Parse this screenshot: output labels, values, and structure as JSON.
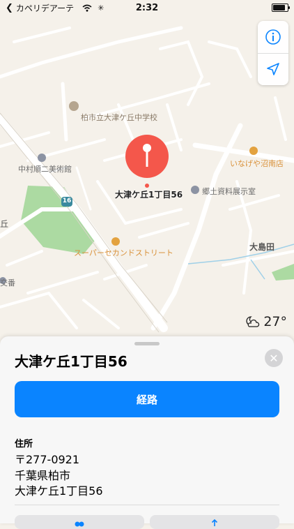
{
  "status_bar": {
    "back_app": "カペリデアーテ",
    "time": "2:32"
  },
  "map": {
    "pin_label": "大津ケ丘1丁目56",
    "places": {
      "school": "柏市立大津ケ丘中学校",
      "museum": "中村順二美術館",
      "store": "いなげや沼南店",
      "exhibit": "郷土資料展示室",
      "supermarket": "スーパーセカンドストリート",
      "district": "大島田",
      "edge_left": "丘",
      "koban": "交番"
    },
    "route_number": "16",
    "weather": {
      "temperature": "27°"
    }
  },
  "sheet": {
    "title": "大津ケ丘1丁目56",
    "route_button": "経路",
    "address_label": "住所",
    "address_lines": [
      "〒277-0921",
      "千葉県柏市",
      "大津ケ丘1丁目56"
    ]
  },
  "colors": {
    "accent": "#0a84ff",
    "pin": "#f4574b",
    "park": "#a9d9a0",
    "map_bg": "#f5f1ea",
    "label_orange": "#d9913a",
    "label_gray": "#6b6b6b"
  }
}
